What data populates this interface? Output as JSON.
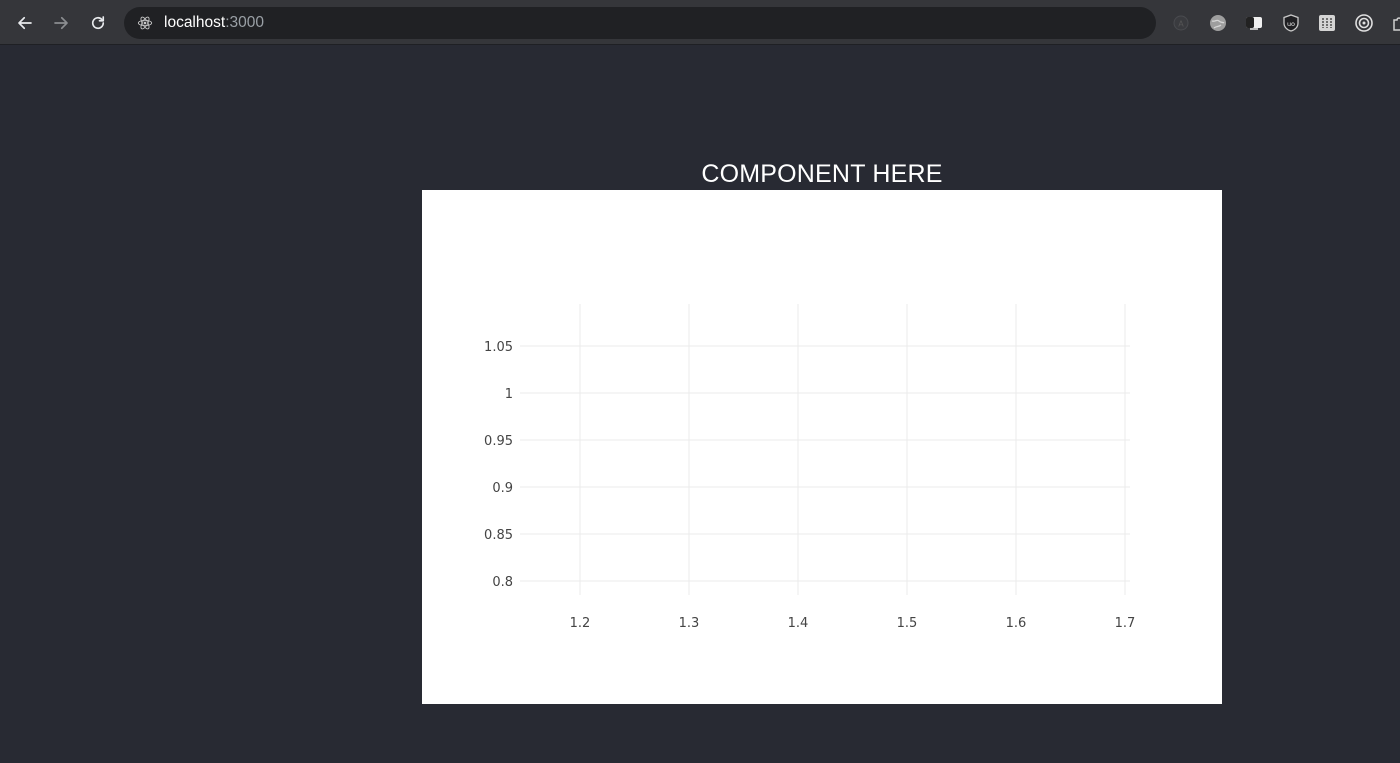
{
  "browser": {
    "url_host": "localhost",
    "url_port": ":3000",
    "icons": {
      "back": "arrow-left-icon",
      "forward": "arrow-right-icon",
      "reload": "reload-icon",
      "site": "react-logo-icon"
    },
    "extensions": [
      {
        "name": "contrast-extension-icon"
      },
      {
        "name": "globe-extension-icon"
      },
      {
        "name": "dark-reader-extension-icon"
      },
      {
        "name": "ublock-origin-extension-icon"
      },
      {
        "name": "grid-extension-icon"
      },
      {
        "name": "target-extension-icon"
      },
      {
        "name": "puzzle-extension-icon"
      }
    ]
  },
  "page": {
    "heading": "COMPONENT HERE"
  },
  "chart_data": {
    "type": "scatter",
    "title": "",
    "xlabel": "",
    "ylabel": "",
    "x_ticks": [
      "1.2",
      "1.3",
      "1.4",
      "1.5",
      "1.6",
      "1.7"
    ],
    "y_ticks": [
      "0.8",
      "0.85",
      "0.9",
      "0.95",
      "1",
      "1.05"
    ],
    "xlim": [
      1.2,
      1.7
    ],
    "ylim": [
      0.8,
      1.05
    ],
    "series": [],
    "grid": true,
    "colors": {
      "grid": "#ebebeb",
      "tick_text": "#444444",
      "background": "#ffffff"
    }
  }
}
